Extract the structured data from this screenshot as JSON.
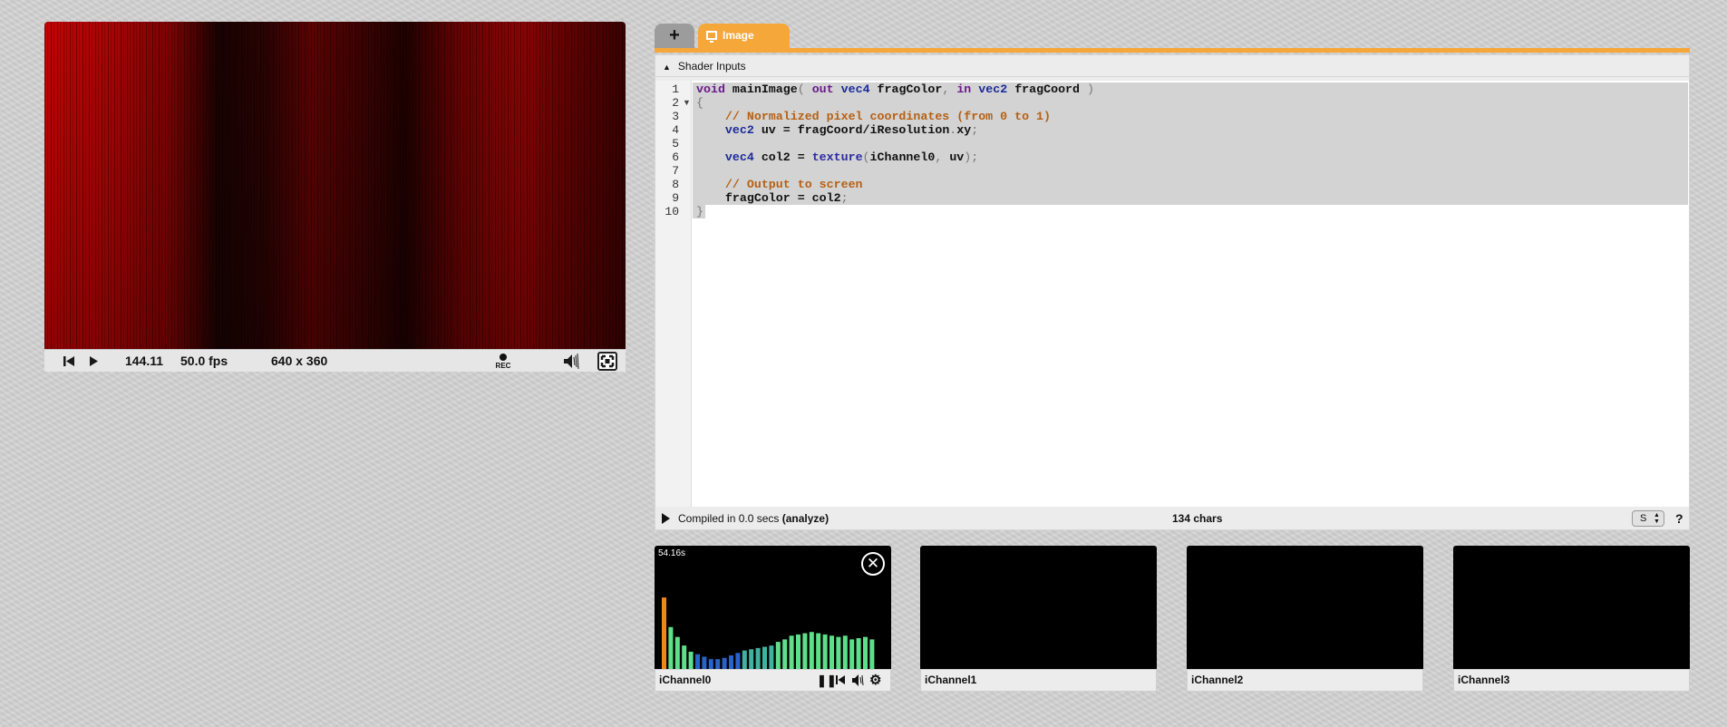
{
  "player": {
    "time": "144.11",
    "fps": "50.0 fps",
    "resolution": "640 x 360",
    "rec_label": "REC"
  },
  "tabs": {
    "add_label": "+",
    "image_label": "Image"
  },
  "editor": {
    "shader_inputs_label": "Shader Inputs",
    "line_numbers": [
      "1",
      "2",
      "3",
      "4",
      "5",
      "6",
      "7",
      "8",
      "9",
      "10"
    ],
    "status": {
      "compiled_text": "Compiled in 0.0 secs ",
      "analyze_label": "(analyze)",
      "char_count": "134 chars",
      "select_value": "S",
      "help_label": "?"
    }
  },
  "channels": [
    {
      "label": "iChannel0",
      "time": "54.16s",
      "levels": [
        0.58,
        0.34,
        0.26,
        0.19,
        0.14,
        0.12,
        0.1,
        0.08,
        0.08,
        0.09,
        0.11,
        0.13,
        0.15,
        0.16,
        0.17,
        0.18,
        0.19,
        0.22,
        0.24,
        0.27,
        0.28,
        0.29,
        0.3,
        0.29,
        0.28,
        0.27,
        0.26,
        0.27,
        0.24,
        0.25,
        0.26,
        0.24
      ]
    },
    {
      "label": "iChannel1"
    },
    {
      "label": "iChannel2"
    },
    {
      "label": "iChannel3"
    }
  ],
  "colors": {
    "accent_tab": "#f5a73a",
    "bar_orange": "#f0861a",
    "bar_green": "#5ee08a",
    "bar_blue": "#2a62c8"
  }
}
